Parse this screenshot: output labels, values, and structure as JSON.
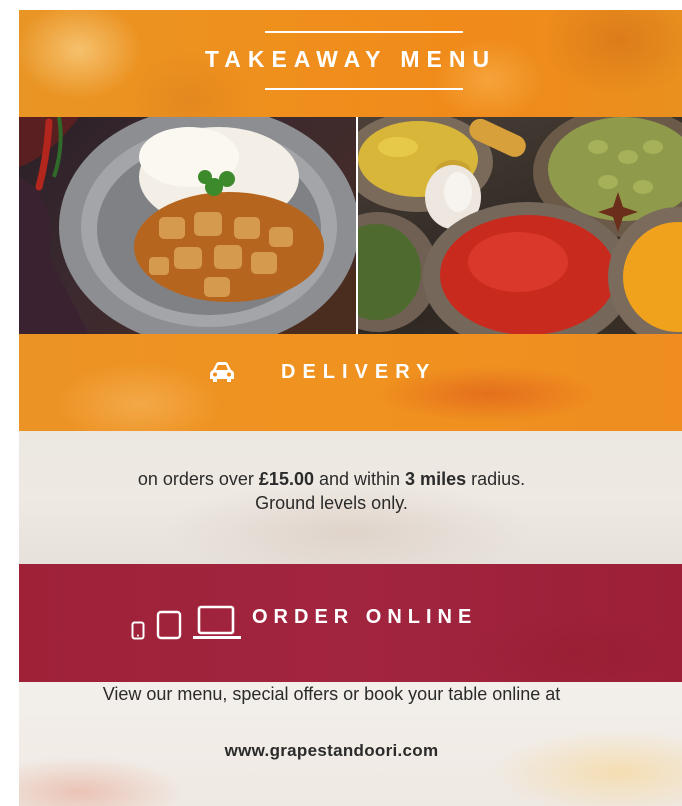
{
  "header": {
    "title": "TAKEAWAY MENU"
  },
  "photos": {
    "left_icon": "curry-rice-plate-photo",
    "right_icon": "spice-bowls-photo"
  },
  "delivery": {
    "title": "DELIVERY",
    "icon": "car-icon",
    "text_part1": "on orders over ",
    "min_order": "£15.00",
    "text_part2": " and within ",
    "radius": "3 miles",
    "text_part3": " radius.",
    "line2": "Ground levels only."
  },
  "order_online": {
    "title": "ORDER ONLINE",
    "icons": [
      "phone-icon",
      "tablet-icon",
      "laptop-icon"
    ],
    "description": "View our menu, special offers or book your table online at",
    "url": "www.grapestandoori.com"
  },
  "colors": {
    "orange": "#ef8f1f",
    "crimson": "#a0223b",
    "cream": "#ece7e1",
    "text": "#2b2b2b"
  }
}
